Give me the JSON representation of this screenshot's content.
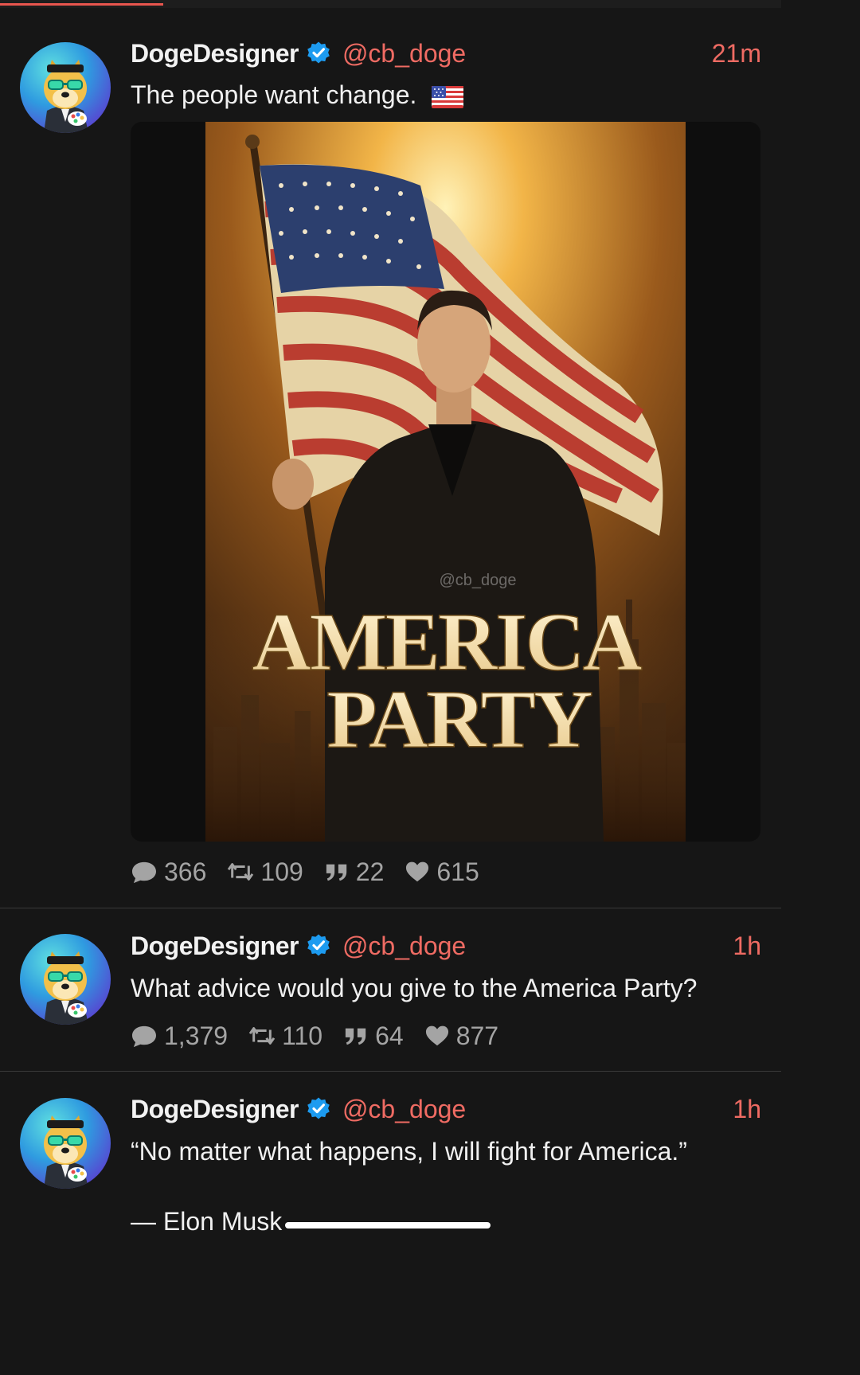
{
  "posts": [
    {
      "name": "DogeDesigner",
      "handle": "@cb_doge",
      "time": "21m",
      "text": "The people want change.",
      "media": {
        "headline_line1": "AMERICA",
        "headline_line2": "PARTY",
        "watermark": "@cb_doge"
      },
      "stats": {
        "replies": "366",
        "reposts": "109",
        "quotes": "22",
        "likes": "615"
      }
    },
    {
      "name": "DogeDesigner",
      "handle": "@cb_doge",
      "time": "1h",
      "text": "What advice would you give to the America Party?",
      "stats": {
        "replies": "1,379",
        "reposts": "110",
        "quotes": "64",
        "likes": "877"
      }
    },
    {
      "name": "DogeDesigner",
      "handle": "@cb_doge",
      "time": "1h",
      "text": "“No matter what happens, I will fight for America.”",
      "attribution": "— Elon Musk"
    }
  ],
  "colors": {
    "accent": "#ef6b63",
    "verified": "#1d9bf0",
    "background": "#161616",
    "muted": "#a4a4a4"
  }
}
